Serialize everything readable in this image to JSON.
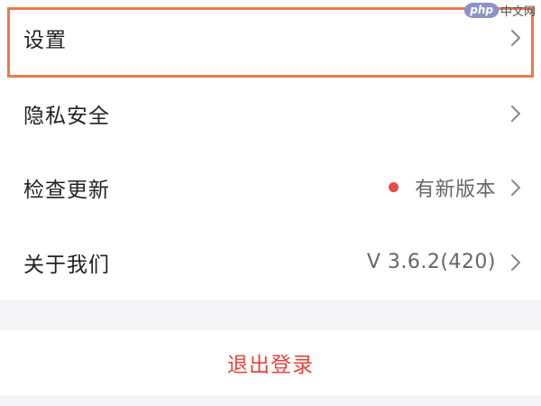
{
  "menu": {
    "items": [
      {
        "label": "设置",
        "value": "",
        "chevron_icon": "chevron-right-icon"
      },
      {
        "label": "隐私安全",
        "value": "",
        "chevron_icon": "chevron-right-icon"
      },
      {
        "label": "检查更新",
        "value": "有新版本",
        "badge_color": "#e84a4a",
        "chevron_icon": "chevron-right-icon"
      },
      {
        "label": "关于我们",
        "value": "V 3.6.2(420)",
        "chevron_icon": "chevron-right-icon"
      }
    ],
    "highlight_color": "#ec7a4a"
  },
  "logout": {
    "label": "退出登录",
    "color": "#e8433b"
  },
  "watermark": {
    "badge": "php",
    "text": "中文网"
  }
}
